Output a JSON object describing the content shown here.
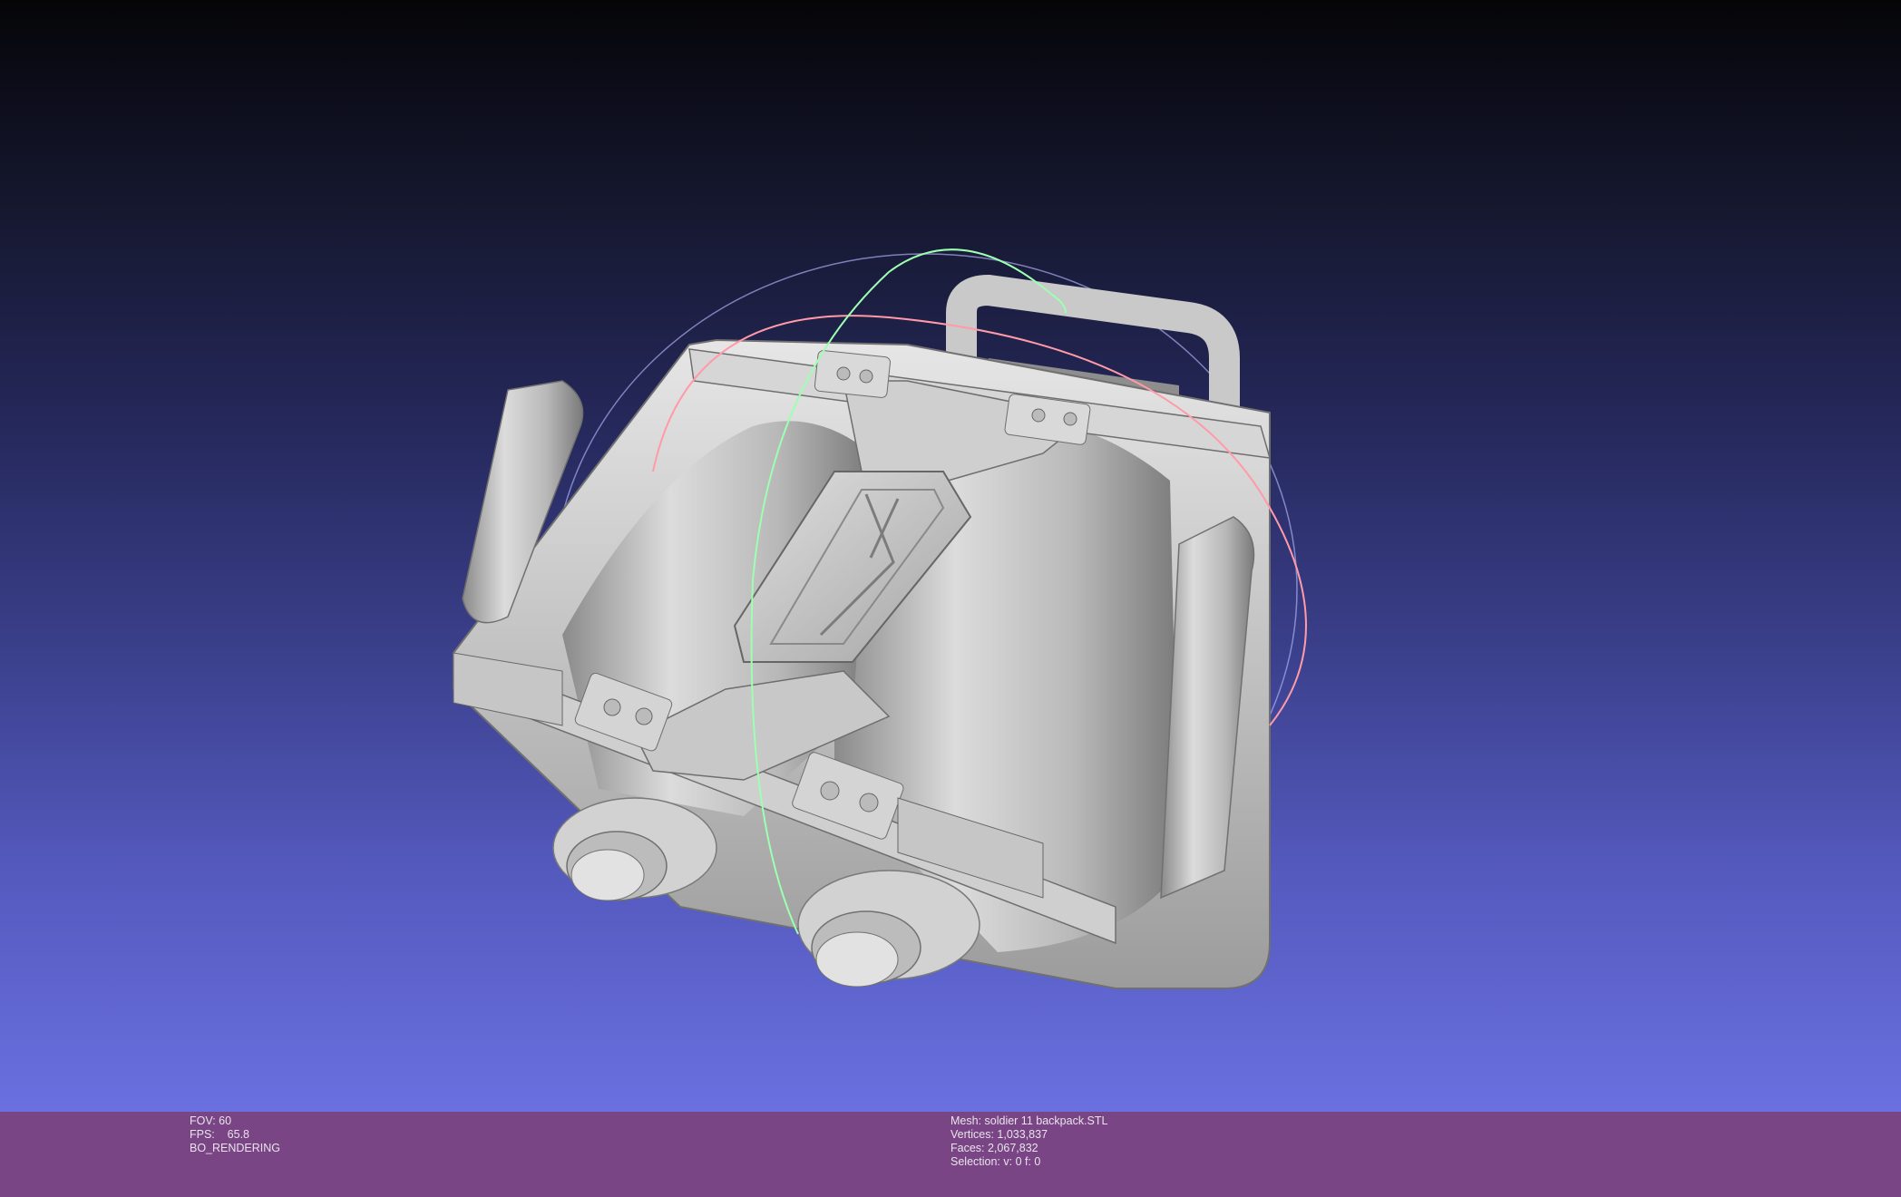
{
  "viewer": {
    "background_top": "#050508",
    "background_bottom": "#6a70e0",
    "info_bar_color": "#7a4585"
  },
  "status_left": {
    "fov": "FOV: 60",
    "fps": "FPS:    65.8",
    "mode": "BO_RENDERING"
  },
  "status_right": {
    "mesh": "Mesh: soldier 11 backpack.STL",
    "vertices": "Vertices: 1,033,837",
    "faces": "Faces: 2,067,832",
    "selection": "Selection: v: 0 f: 0"
  },
  "model": {
    "description_icon": "backpack-mesh",
    "trackball_colors": [
      "#ff9aa8",
      "#9dffb0",
      "#b0b4ff"
    ]
  }
}
